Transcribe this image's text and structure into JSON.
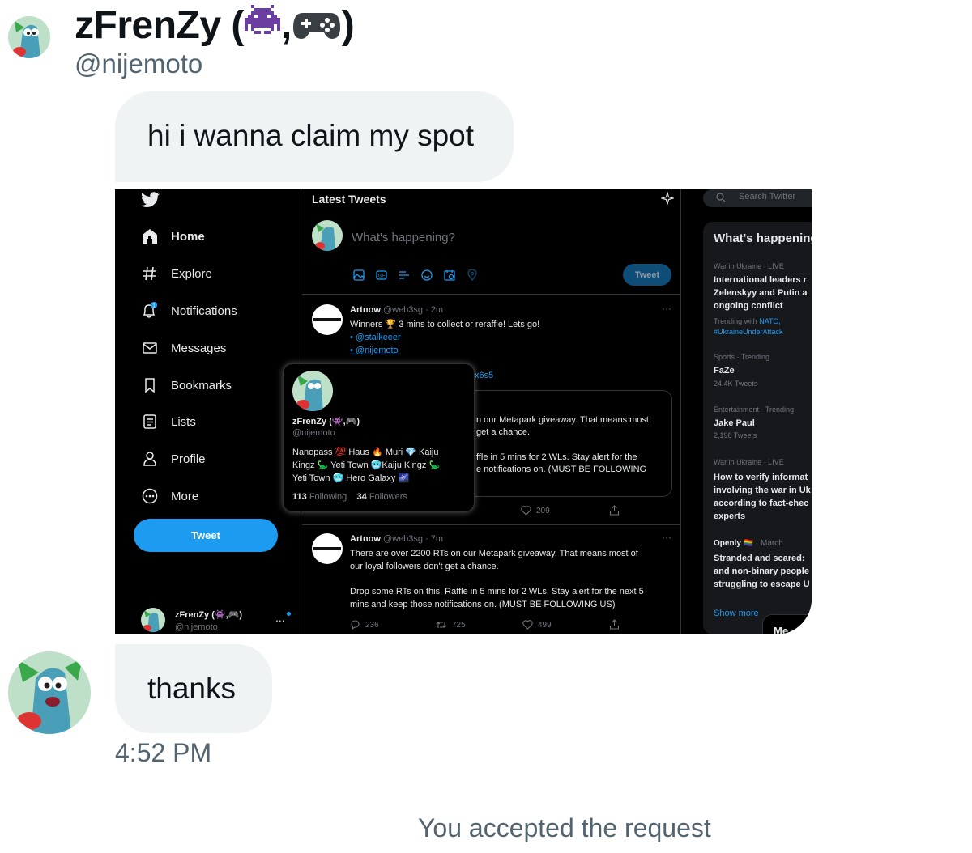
{
  "colors": {
    "bubble": "#eff3f4",
    "accent": "#1d9bf0",
    "muted": "#536471",
    "dark_bg": "#000000"
  },
  "header": {
    "name": "zFrenZy (",
    "name_sep": ",",
    "name_end": ")",
    "handle": "@nijemoto",
    "icons": [
      "alien-monster-icon",
      "game-controller-icon"
    ]
  },
  "messages": [
    {
      "text": "hi i wanna claim my spot"
    },
    {
      "text": "thanks"
    }
  ],
  "timestamp": "4:52 PM",
  "status": "You accepted the request",
  "screenshot": {
    "nav": [
      {
        "label": "Home",
        "icon": "home-icon"
      },
      {
        "label": "Explore",
        "icon": "hashtag-icon"
      },
      {
        "label": "Notifications",
        "icon": "bell-icon",
        "badge": "1"
      },
      {
        "label": "Messages",
        "icon": "envelope-icon"
      },
      {
        "label": "Bookmarks",
        "icon": "bookmark-icon"
      },
      {
        "label": "Lists",
        "icon": "list-icon"
      },
      {
        "label": "Profile",
        "icon": "person-icon"
      },
      {
        "label": "More",
        "icon": "more-circle-icon"
      }
    ],
    "tweet_button": "Tweet",
    "account": {
      "name": "zFrenZy (👾,🎮)",
      "handle": "@nijemoto",
      "more": "..."
    },
    "timeline": {
      "title": "Latest Tweets",
      "compose_placeholder": "What's happening?",
      "compose_button": "Tweet"
    },
    "tweet1": {
      "name": "Artnow",
      "meta": "@web3sg · 2m",
      "line1": "Winners 🏆 3 mins to collect or reraffle! Lets go!",
      "mention1": "• @stalkeeer",
      "mention2": "• @nijemoto",
      "partial_link": "x6s5",
      "quote_line1": "n our Metapark giveaway. That means most",
      "quote_line2": "get a chance.",
      "quote_line3": "ffle in 5 mins for 2 WLs. Stay alert for the",
      "quote_line4": "e notifications on. (MUST BE FOLLOWING",
      "likes": "209"
    },
    "tweet2": {
      "name": "Artnow",
      "meta": "@web3sg · 7m",
      "line1": "There are over 2200 RTs on our Metapark giveaway. That means most of",
      "line2": "our loyal followers don't get a chance.",
      "line3": "Drop some RTs on this. Raffle in 5 mins for 2 WLs. Stay alert for the next 5",
      "line4": "mins and keep those notifications on. (MUST BE FOLLOWING US)",
      "replies": "236",
      "retweets": "725",
      "likes": "499"
    },
    "hover_card": {
      "name": "zFrenZy (👾,🎮)",
      "handle": "@nijemoto",
      "bio_line1": "Nanopass 💯 Haus 🔥 Muri 💎 Kaiju",
      "bio_line2": "Kingz 🦕 Yeti Town 🥶Kaiju Kingz 🦕",
      "bio_line3": "Yeti Town 🥶 Hero Galaxy 🌌",
      "following_count": "113",
      "following_label": "Following",
      "followers_count": "34",
      "followers_label": "Followers"
    },
    "sidebar": {
      "search_placeholder": "Search Twitter",
      "title": "What's happening",
      "trends": [
        {
          "meta": "War in Ukraine · LIVE",
          "lines": [
            "International leaders r",
            "Zelenskyy and Putin a",
            "ongoing conflict"
          ],
          "extra_meta": "Trending with",
          "links": [
            "NATO,",
            "#UkraineUnderAttack"
          ]
        },
        {
          "meta": "Sports · Trending",
          "lines": [
            "FaZe"
          ],
          "count": "24.4K Tweets"
        },
        {
          "meta": "Entertainment · Trending",
          "lines": [
            "Jake Paul"
          ],
          "count": "2,198 Tweets"
        },
        {
          "meta": "War in Ukraine · LIVE",
          "lines": [
            "How to verify informat",
            "involving the war in Uk",
            "according to fact-chec",
            "experts"
          ]
        },
        {
          "meta": "· March",
          "source": "Openly 🏳️‍🌈",
          "lines": [
            "Stranded and scared:",
            "and non-binary people",
            "struggling to escape U"
          ]
        }
      ],
      "show_more": "Show more",
      "messages_drawer": "Me"
    }
  }
}
